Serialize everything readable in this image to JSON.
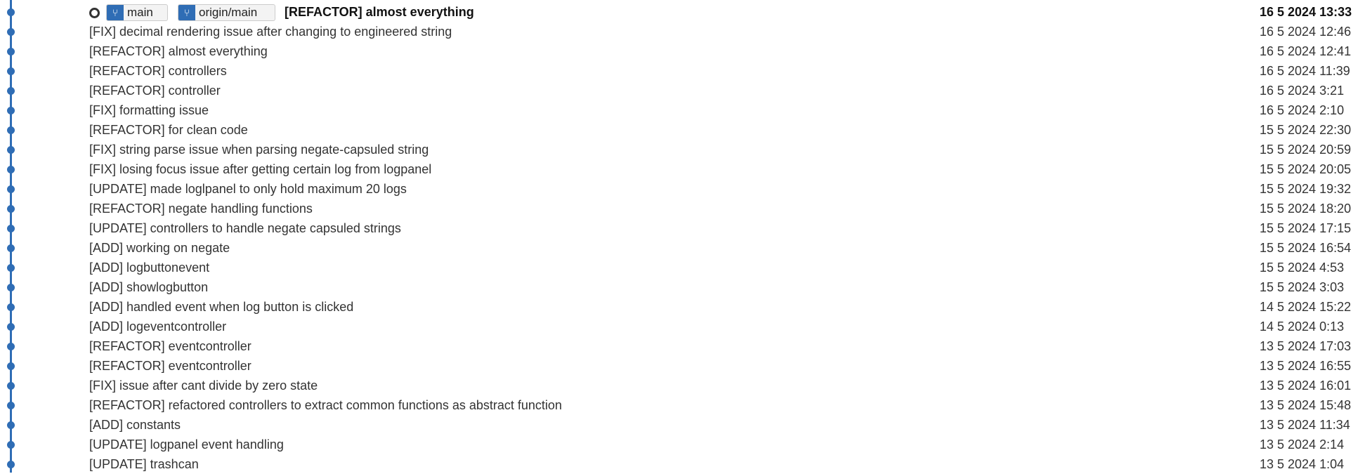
{
  "head": {
    "branches": [
      {
        "label": "main",
        "icon": "branch-icon"
      },
      {
        "label": "origin/main",
        "icon": "branch-icon"
      }
    ]
  },
  "commits": [
    {
      "message": "[REFACTOR] almost everything",
      "date": "16 5 2024 13:33"
    },
    {
      "message": "[FIX] decimal rendering issue after changing to engineered string",
      "date": "16 5 2024 12:46"
    },
    {
      "message": "[REFACTOR] almost everything",
      "date": "16 5 2024 12:41"
    },
    {
      "message": "[REFACTOR] controllers",
      "date": "16 5 2024 11:39"
    },
    {
      "message": "[REFACTOR] controller",
      "date": "16 5 2024 3:21"
    },
    {
      "message": "[FIX] formatting issue",
      "date": "16 5 2024 2:10"
    },
    {
      "message": "[REFACTOR] for clean code",
      "date": "15 5 2024 22:30"
    },
    {
      "message": "[FIX] string parse issue when parsing negate-capsuled string",
      "date": "15 5 2024 20:59"
    },
    {
      "message": "[FIX] losing focus issue after getting certain log from logpanel",
      "date": "15 5 2024 20:05"
    },
    {
      "message": "[UPDATE] made loglpanel to only hold maximum 20 logs",
      "date": "15 5 2024 19:32"
    },
    {
      "message": "[REFACTOR] negate handling functions",
      "date": "15 5 2024 18:20"
    },
    {
      "message": "[UPDATE] controllers to handle negate capsuled strings",
      "date": "15 5 2024 17:15"
    },
    {
      "message": "[ADD] working on negate",
      "date": "15 5 2024 16:54"
    },
    {
      "message": "[ADD] logbuttonevent",
      "date": "15 5 2024 4:53"
    },
    {
      "message": "[ADD] showlogbutton",
      "date": "15 5 2024 3:03"
    },
    {
      "message": "[ADD] handled event when log button is clicked",
      "date": "14 5 2024 15:22"
    },
    {
      "message": "[ADD] logeventcontroller",
      "date": "14 5 2024 0:13"
    },
    {
      "message": "[REFACTOR] eventcontroller",
      "date": "13 5 2024 17:03"
    },
    {
      "message": "[REFACTOR] eventcontroller",
      "date": "13 5 2024 16:55"
    },
    {
      "message": "[FIX] issue after cant divide by zero state",
      "date": "13 5 2024 16:01"
    },
    {
      "message": "[REFACTOR] refactored controllers to extract common functions as abstract function",
      "date": "13 5 2024 15:48"
    },
    {
      "message": "[ADD] constants",
      "date": "13 5 2024 11:34"
    },
    {
      "message": "[UPDATE] logpanel event handling",
      "date": "13 5 2024 2:14"
    },
    {
      "message": "[UPDATE] trashcan",
      "date": "13 5 2024 1:04"
    }
  ],
  "colors": {
    "graph": "#2f6db5"
  }
}
